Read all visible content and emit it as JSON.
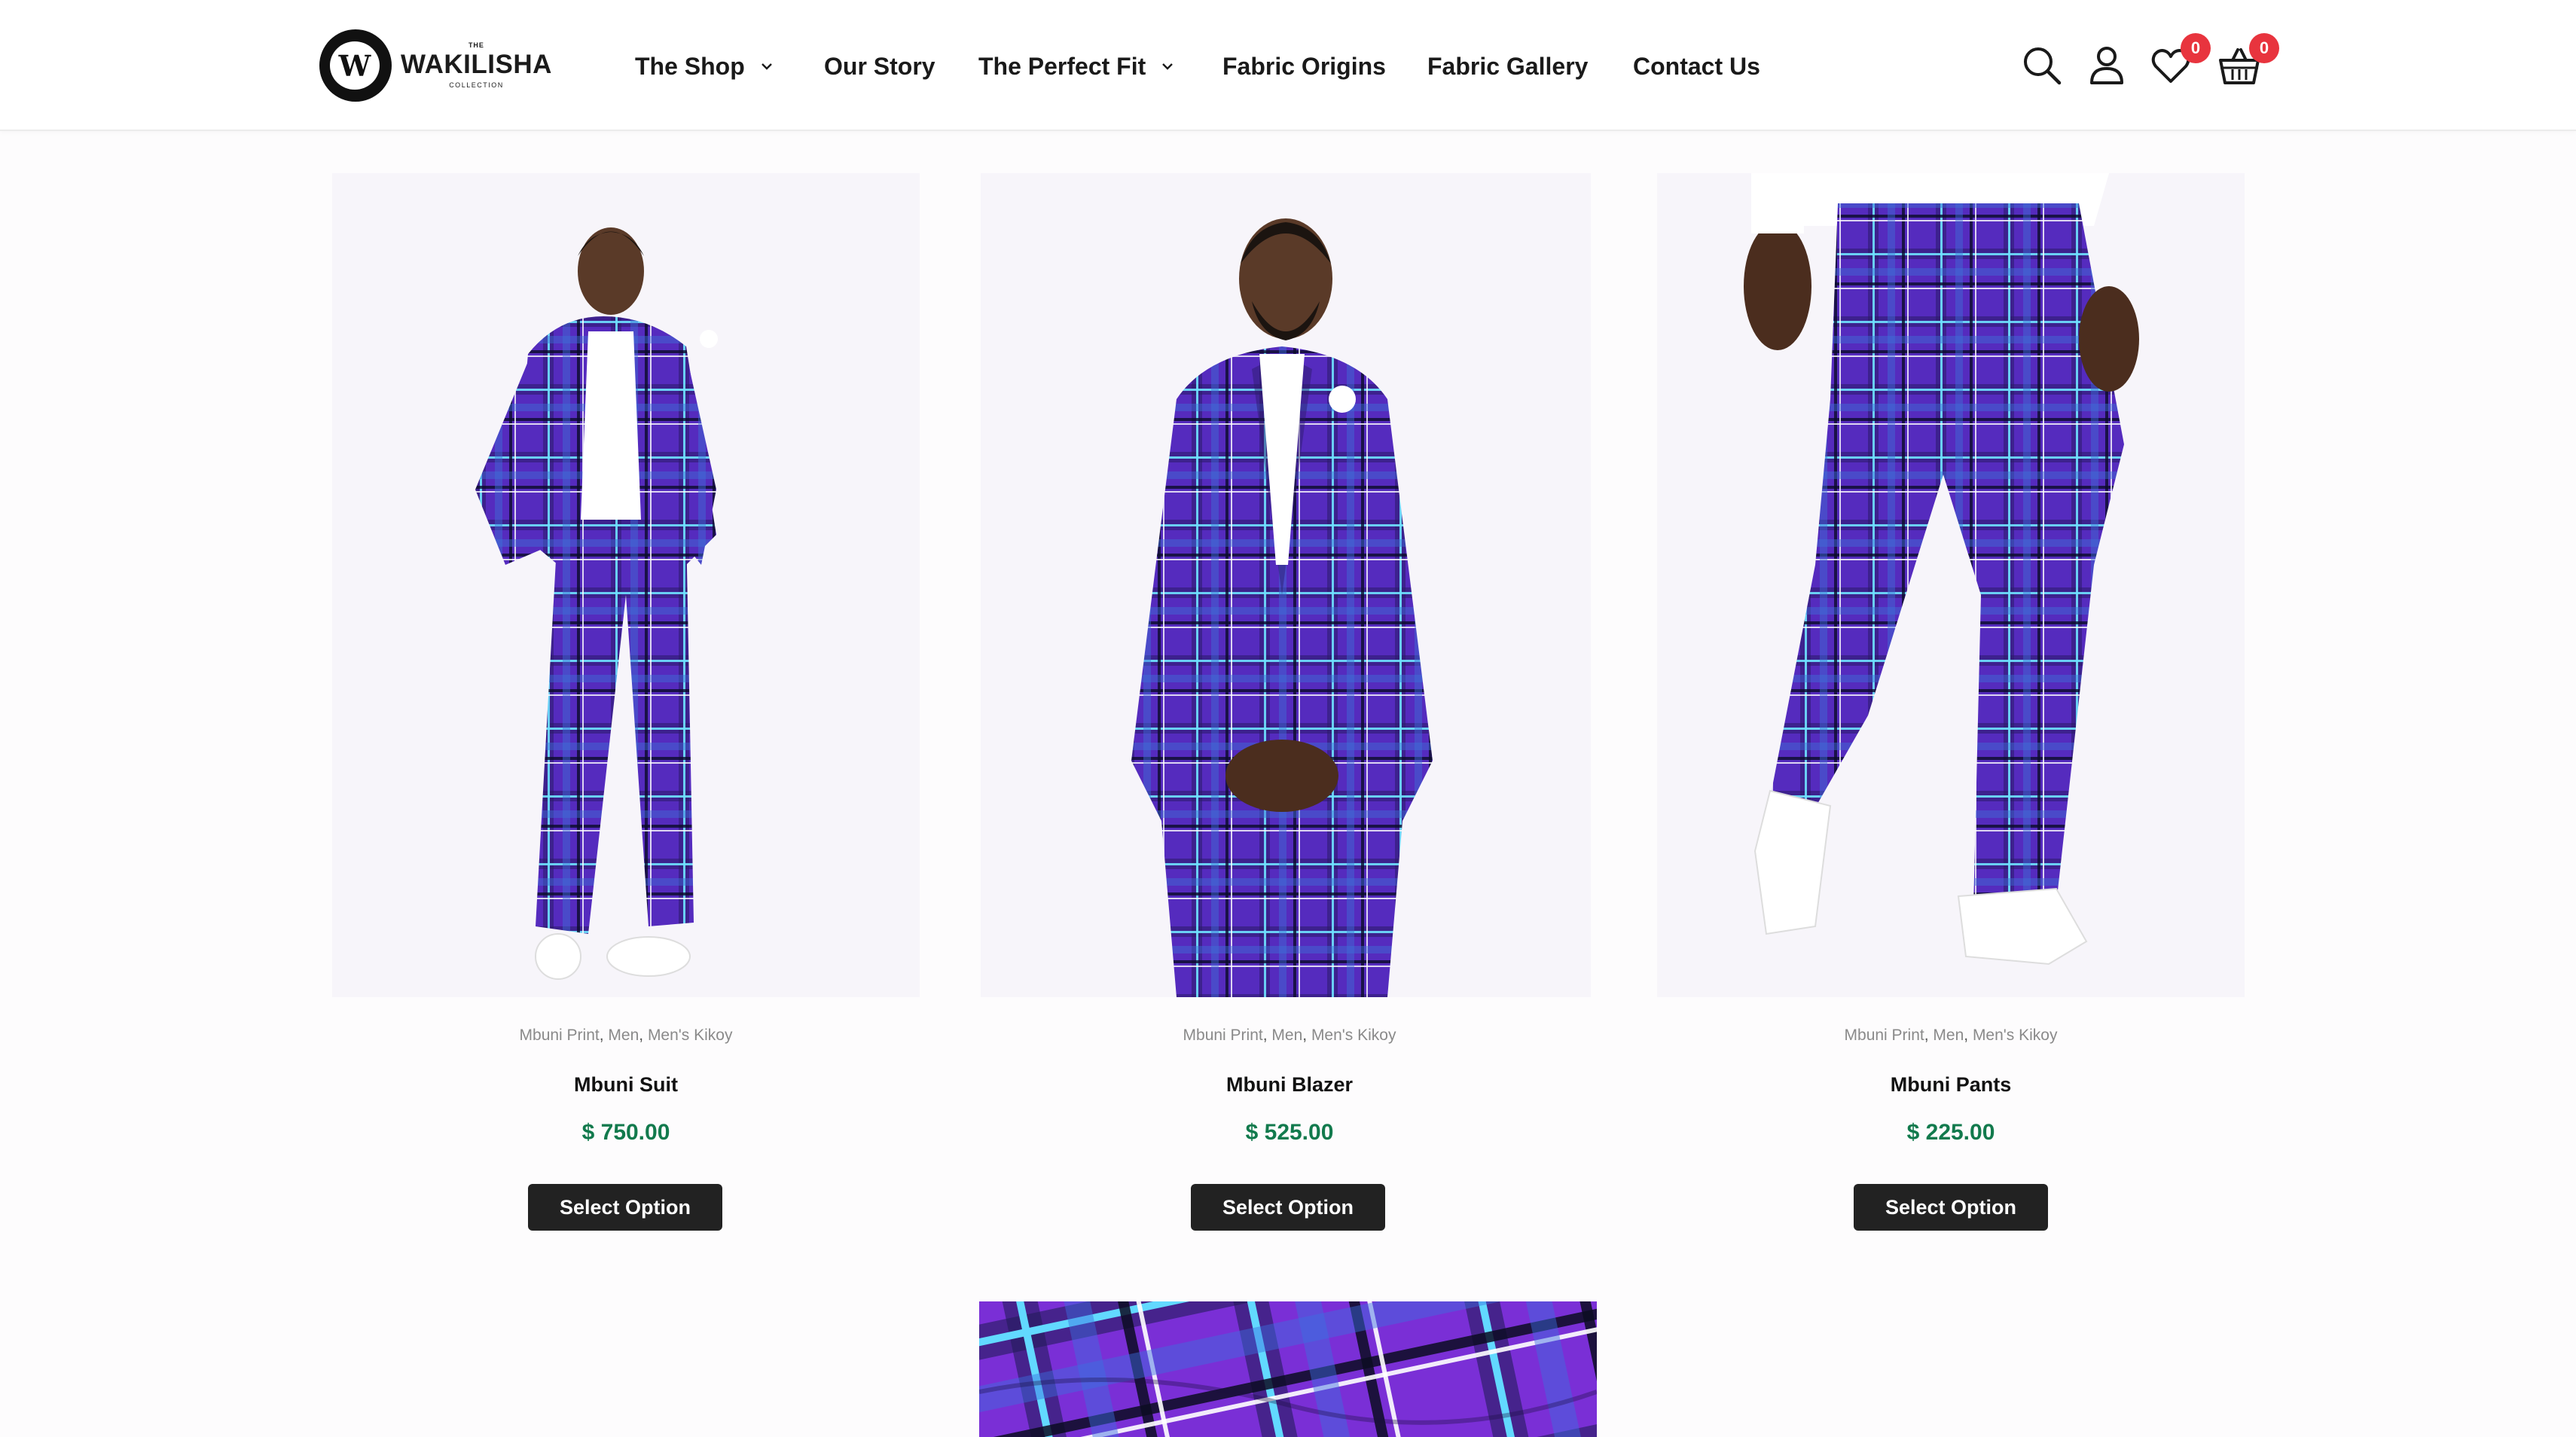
{
  "header": {
    "logo": {
      "the": "THE",
      "brand": "WAKILISHA",
      "collection": "COLLECTION",
      "mark": "W"
    },
    "nav": [
      {
        "label": "The Shop",
        "dropdown": true
      },
      {
        "label": "Our Story",
        "dropdown": false
      },
      {
        "label": "The Perfect Fit",
        "dropdown": true
      },
      {
        "label": "Fabric Origins",
        "dropdown": false
      },
      {
        "label": "Fabric Gallery",
        "dropdown": false
      },
      {
        "label": "Contact Us",
        "dropdown": false
      }
    ],
    "icons": [
      "search-icon",
      "user-icon",
      "heart-icon",
      "basket-icon"
    ],
    "wishlist_count": "0",
    "cart_count": "0"
  },
  "products": [
    {
      "categories": [
        "Mbuni Print",
        "Men",
        "Men's Kikoy"
      ],
      "name": "Mbuni Suit",
      "price": "$ 750.00",
      "button": "Select Option"
    },
    {
      "categories": [
        "Mbuni Print",
        "Men",
        "Men's Kikoy"
      ],
      "name": "Mbuni Blazer",
      "price": "$ 525.00",
      "button": "Select Option"
    },
    {
      "categories": [
        "Mbuni Print",
        "Men",
        "Men's Kikoy"
      ],
      "name": "Mbuni Pants",
      "price": "$ 225.00",
      "button": "Select Option"
    }
  ],
  "colors": {
    "price": "#127a4d",
    "button_bg": "#222222",
    "badge": "#e8343e",
    "plaid_purple": "#5b2fc9"
  }
}
